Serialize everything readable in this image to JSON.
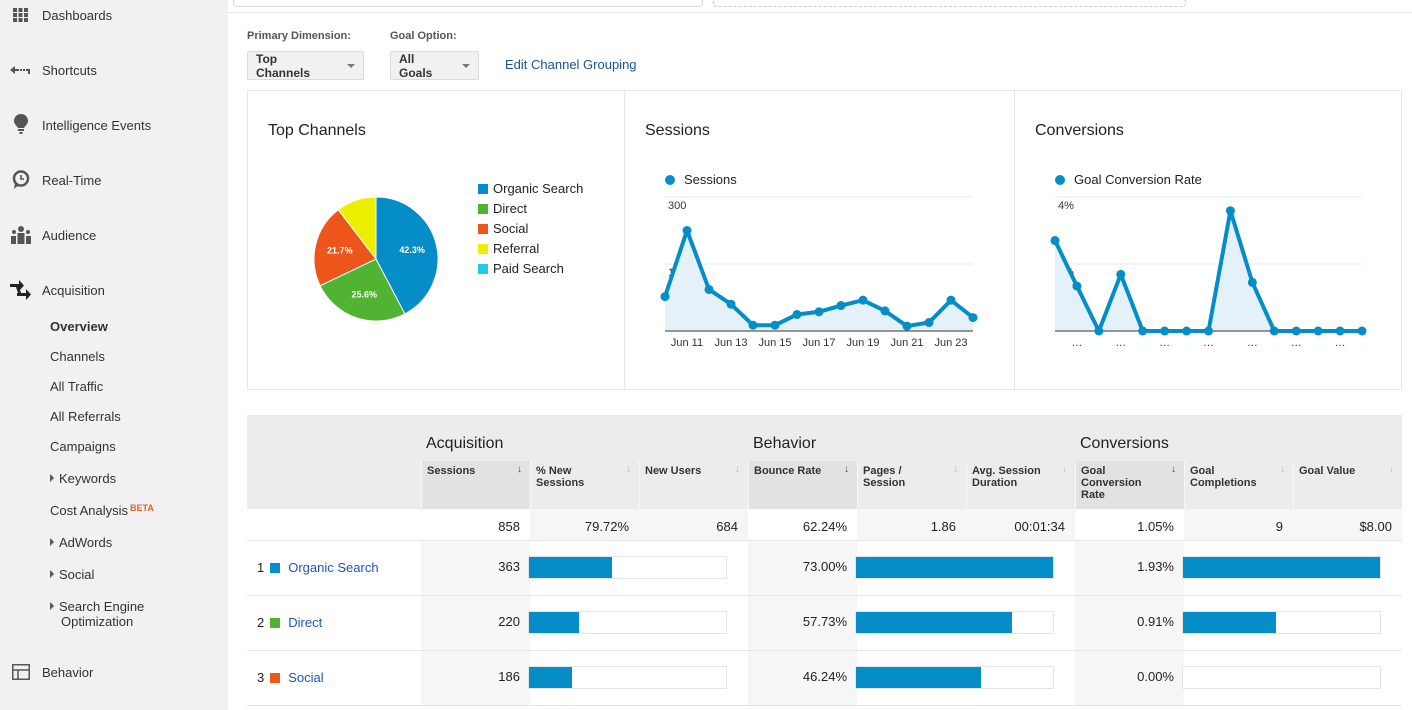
{
  "sidebar": {
    "items": [
      {
        "label": "Dashboards",
        "icon": "grid-icon"
      },
      {
        "label": "Shortcuts",
        "icon": "shortcut-arrow-icon"
      },
      {
        "label": "Intelligence Events",
        "icon": "lightbulb-icon"
      },
      {
        "label": "Real-Time",
        "icon": "clock-bubble-icon"
      },
      {
        "label": "Audience",
        "icon": "people-icon"
      },
      {
        "label": "Acquisition",
        "icon": "acquisition-arrows-icon"
      }
    ],
    "acquisition_sub": [
      {
        "label": "Overview",
        "active": true
      },
      {
        "label": "Channels"
      },
      {
        "label": "All Traffic"
      },
      {
        "label": "All Referrals"
      },
      {
        "label": "Campaigns"
      },
      {
        "label": "Keywords",
        "expandable": true
      },
      {
        "label": "Cost Analysis",
        "badge": "BETA"
      },
      {
        "label": "AdWords",
        "expandable": true
      },
      {
        "label": "Social",
        "expandable": true
      },
      {
        "label": "Search Engine",
        "label2": "Optimization",
        "expandable": true
      }
    ],
    "behavior": {
      "label": "Behavior",
      "icon": "layout-icon"
    }
  },
  "controls": {
    "primary_dimension_label": "Primary Dimension:",
    "primary_dimension_value": "Top Channels",
    "goal_option_label": "Goal Option:",
    "goal_option_value": "All Goals",
    "edit_link": "Edit Channel Grouping"
  },
  "colors": {
    "accent": "#058dc7",
    "organic": "#058dc7",
    "direct": "#50b432",
    "social": "#ed561b",
    "referral": "#edef00",
    "paid": "#24cbe5",
    "link": "#1b55c0"
  },
  "chart_data": [
    {
      "type": "pie",
      "title": "Top Channels",
      "categories": [
        "Organic Search",
        "Direct",
        "Social",
        "Referral",
        "Paid Search"
      ],
      "values": [
        42.3,
        25.6,
        21.7,
        10.4,
        0
      ],
      "data_labels": [
        "42.3%",
        "25.6%",
        "21.7%",
        "",
        ""
      ],
      "legend": "right"
    },
    {
      "type": "area",
      "title": "Sessions",
      "series": [
        {
          "name": "Sessions",
          "values": [
            77,
            225,
            93,
            60,
            13,
            13,
            37,
            43,
            57,
            69,
            45,
            11,
            19,
            69,
            30
          ]
        }
      ],
      "x": [
        "Jun 10",
        "Jun 11",
        "Jun 12",
        "Jun 13",
        "Jun 14",
        "Jun 15",
        "Jun 16",
        "Jun 17",
        "Jun 18",
        "Jun 19",
        "Jun 20",
        "Jun 21",
        "Jun 22",
        "Jun 23",
        "Jun 24"
      ],
      "x_tick_labels": [
        "Jun 11",
        "Jun 13",
        "Jun 15",
        "Jun 17",
        "Jun 19",
        "Jun 21",
        "Jun 23"
      ],
      "y_tick_labels": [
        "300",
        "150"
      ],
      "ylim": [
        0,
        300
      ],
      "grid": true
    },
    {
      "type": "area",
      "title": "Conversions",
      "series": [
        {
          "name": "Goal Conversion Rate",
          "values": [
            2.7,
            1.34,
            0,
            1.69,
            0,
            0,
            0,
            0,
            3.59,
            1.45,
            0,
            0,
            0,
            0,
            0
          ]
        }
      ],
      "x_tick_labels": [
        "…",
        "…",
        "…",
        "…",
        "…",
        "…",
        "…"
      ],
      "y_tick_labels": [
        "4%",
        "2%"
      ],
      "ylim": [
        0,
        4
      ],
      "grid": true
    }
  ],
  "table": {
    "groups": [
      "Acquisition",
      "Behavior",
      "Conversions"
    ],
    "columns": [
      {
        "label": "Sessions",
        "sorted": true
      },
      {
        "label": "% New Sessions"
      },
      {
        "label": "New Users"
      },
      {
        "label": "Bounce Rate"
      },
      {
        "label": "Pages / Session"
      },
      {
        "label": "Avg. Session Duration"
      },
      {
        "label": "Goal Conversion Rate"
      },
      {
        "label": "Goal Completions"
      },
      {
        "label": "Goal Value"
      }
    ],
    "sort_arrow": "↓",
    "totals": [
      "858",
      "79.72%",
      "684",
      "62.24%",
      "1.86",
      "00:01:34",
      "1.05%",
      "9",
      "$8.00"
    ],
    "rows": [
      {
        "rank": "1",
        "channel": "Organic Search",
        "color": "#058dc7",
        "sessions": "363",
        "sessions_pct": 42.3,
        "bounce": "73.00%",
        "bounce_pct": 100,
        "conv": "1.93%",
        "conv_pct": 100
      },
      {
        "rank": "2",
        "channel": "Direct",
        "color": "#50b432",
        "sessions": "220",
        "sessions_pct": 25.6,
        "bounce": "57.73%",
        "bounce_pct": 79.1,
        "conv": "0.91%",
        "conv_pct": 47.2
      },
      {
        "rank": "3",
        "channel": "Social",
        "color": "#ed561b",
        "sessions": "186",
        "sessions_pct": 21.7,
        "bounce": "46.24%",
        "bounce_pct": 63.3,
        "conv": "0.00%",
        "conv_pct": 0
      }
    ]
  }
}
